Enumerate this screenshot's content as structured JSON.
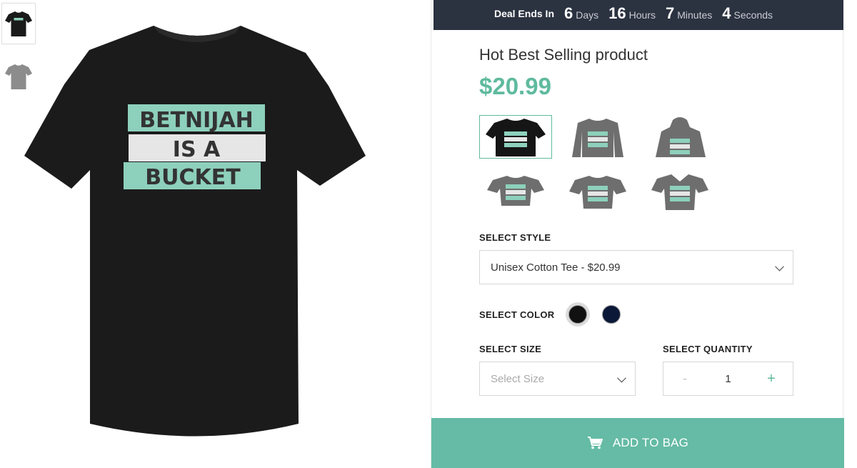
{
  "product": {
    "title": "Hot Best Selling product",
    "price": "$20.99",
    "design_text": [
      "BETNIJAH",
      "IS A",
      "BUCKET"
    ]
  },
  "deal": {
    "label": "Deal Ends In",
    "days": "6",
    "days_unit": "Days",
    "hours": "16",
    "hours_unit": "Hours",
    "minutes": "7",
    "minutes_unit": "Minutes",
    "seconds": "4",
    "seconds_unit": "Seconds"
  },
  "style_section": {
    "label": "SELECT STYLE",
    "selected": "Unisex Cotton Tee - $20.99"
  },
  "color_section": {
    "label": "SELECT COLOR",
    "colors": [
      "#111111",
      "#0b1838"
    ]
  },
  "size_section": {
    "label": "SELECT SIZE",
    "placeholder": "Select Size"
  },
  "quantity_section": {
    "label": "SELECT QUANTITY",
    "minus": "-",
    "value": "1",
    "plus": "+"
  },
  "cta": {
    "label": "ADD TO BAG",
    "icon": "cart-icon"
  },
  "colors": {
    "accent": "#5fba9e",
    "deal_bar": "#2b3240",
    "button": "#65bba5"
  }
}
